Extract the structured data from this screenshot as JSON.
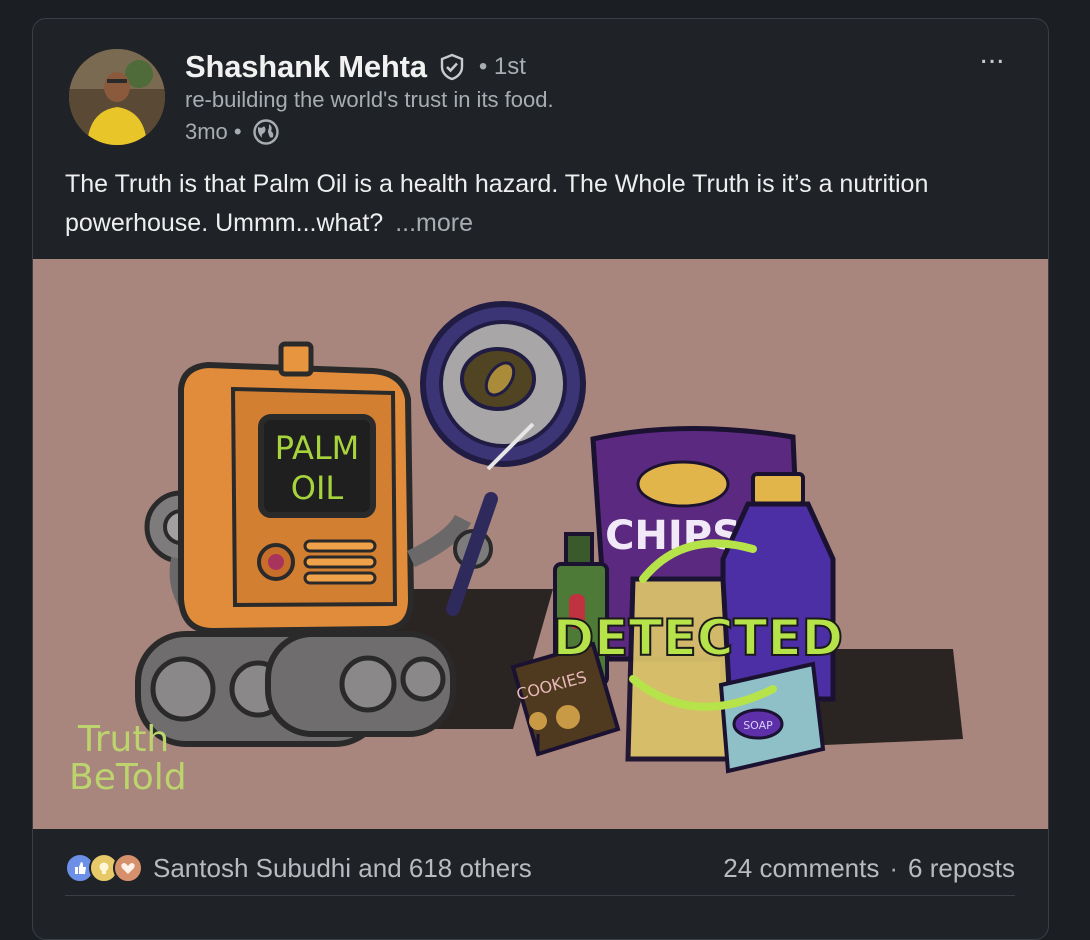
{
  "post": {
    "author": {
      "name": "Shashank Mehta",
      "degree": "• 1st",
      "headline": "re-building the world's trust in its food.",
      "time": "3mo •"
    },
    "text": "The Truth is that Palm Oil is a health hazard. The Whole Truth is it’s a nutrition powerhouse. Ummm...what?",
    "see_more": "...more",
    "more_menu": "...",
    "image": {
      "label_palm": "PALM",
      "label_oil": "OIL",
      "label_chips": "CHIPS",
      "label_detected": "DETECTED",
      "label_cookies": "COOKIES",
      "label_soap": "SOAP",
      "watermark_line1": "Truth",
      "watermark_line2": "BeTold"
    },
    "footer": {
      "reactions_text": "Santosh Subudhi and 618 others",
      "comments": "24 comments",
      "separator": "·",
      "reposts": "6 reposts"
    }
  },
  "colors": {
    "background": "#1b1f23",
    "card": "#1f2328",
    "media_bg": "#a8857d",
    "robot_orange": "#e08c3a",
    "detected_green": "#b7e34a"
  }
}
